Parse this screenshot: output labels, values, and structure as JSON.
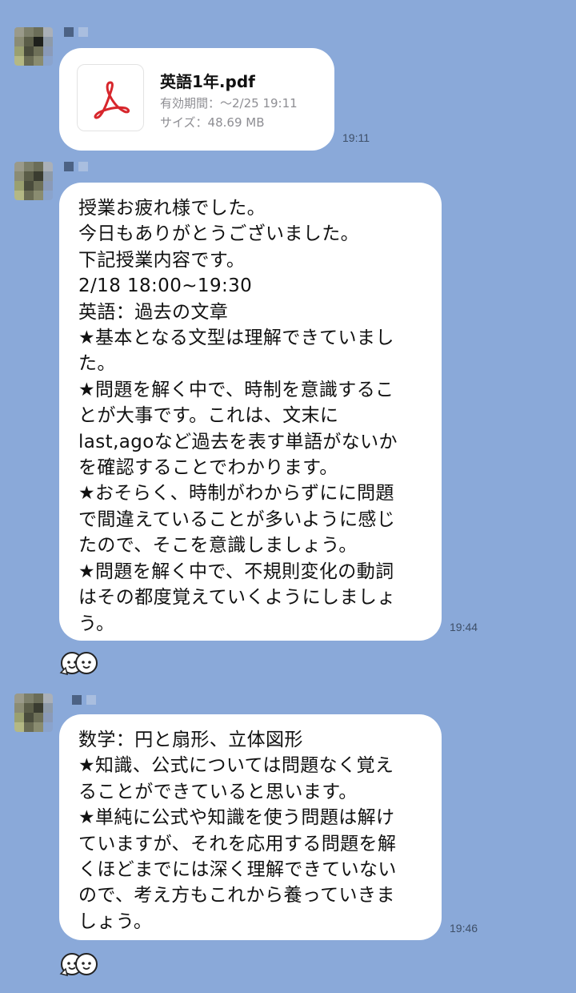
{
  "messages": [
    {
      "type": "file",
      "file_name": "英語1年.pdf",
      "expiry": "有効期間：～2/25 19:11",
      "size": "サイズ：48.69 MB",
      "time": "19:11",
      "icon": "pdf-icon",
      "icon_color": "#d7262c"
    },
    {
      "type": "text",
      "text": "授業お疲れ様でした。\n今日もありがとうございました。\n下記授業内容です。\n2/18 18:00~19:30\n英語：過去の文章\n★基本となる文型は理解できていまし\nた。\n★問題を解く中で、時制を意識するこ\nとが大事です。これは、文末に\nlast,agoなど過去を表す単語がないか\nを確認することでわかります。\n★おそらく、時制がわからずにに問題\nで間違えていることが多いように感じ\nたので、そこを意識しましょう。\n★問題を解く中で、不規則変化の動詞\nはその都度覚えていくようにしましょ\nう。",
      "time": "19:44",
      "reaction": "sticker-faces-icon"
    },
    {
      "type": "text",
      "text": "数学：円と扇形、立体図形\n★知識、公式については問題なく覚え\nることができていると思います。\n★単純に公式や知識を使う問題は解け\nていますが、それを応用する問題を解\nくほどまでには深く理解できていない\nので、考え方もこれから養っていきま\nしょう。",
      "time": "19:46",
      "reaction": "sticker-faces-icon"
    }
  ],
  "colors": {
    "background": "#8aa9d9",
    "bubble": "#ffffff",
    "time_text": "#3e4f68"
  }
}
